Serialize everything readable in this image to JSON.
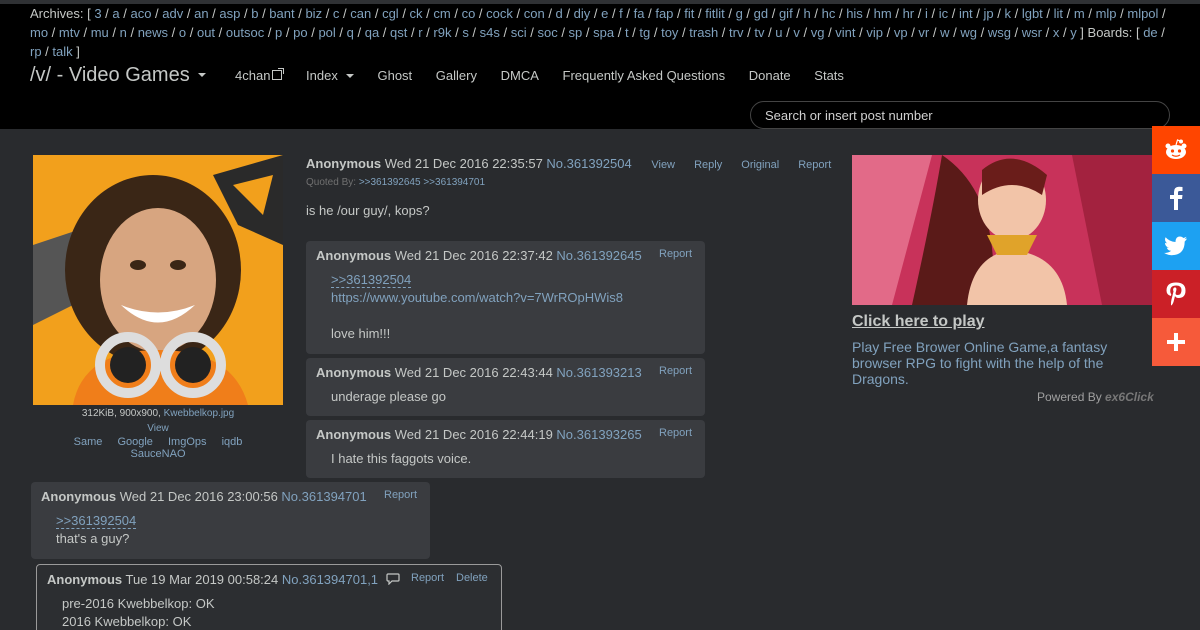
{
  "archives": {
    "label": "Archives:",
    "boards": [
      "3",
      "a",
      "aco",
      "adv",
      "an",
      "asp",
      "b",
      "bant",
      "biz",
      "c",
      "can",
      "cgl",
      "ck",
      "cm",
      "co",
      "cock",
      "con",
      "d",
      "diy",
      "e",
      "f",
      "fa",
      "fap",
      "fit",
      "fitlit",
      "g",
      "gd",
      "gif",
      "h",
      "hc",
      "his",
      "hm",
      "hr",
      "i",
      "ic",
      "int",
      "jp",
      "k",
      "lgbt",
      "lit",
      "m",
      "mlp",
      "mlpol",
      "mo",
      "mtv",
      "mu",
      "n",
      "news",
      "o",
      "out",
      "outsoc",
      "p",
      "po",
      "pol",
      "q",
      "qa",
      "qst",
      "r",
      "r9k",
      "s",
      "s4s",
      "sci",
      "soc",
      "sp",
      "spa",
      "t",
      "tg",
      "toy",
      "trash",
      "trv",
      "tv",
      "u",
      "v",
      "vg",
      "vint",
      "vip",
      "vp",
      "vr",
      "w",
      "wg",
      "wsg",
      "wsr",
      "x",
      "y"
    ],
    "boards_label": "Boards:",
    "boards2": [
      "de",
      "rp",
      "talk"
    ]
  },
  "header": {
    "board_title": "/v/ - Video Games",
    "nav": [
      "4chan",
      "Index",
      "Ghost",
      "Gallery",
      "DMCA",
      "Frequently Asked Questions",
      "Donate",
      "Stats"
    ],
    "search_placeholder": "Search or insert post number"
  },
  "op": {
    "name": "Anonymous",
    "date": "Wed 21 Dec 2016 22:35:57",
    "num": "No.361392504",
    "controls": [
      "View",
      "Reply",
      "Original",
      "Report"
    ],
    "quoted_by_label": "Quoted By:",
    "quoted_by": ">>361392645 >>361394701",
    "body": "is he /our guy/, kops?",
    "file_info": "312KiB, 900x900,",
    "file_name": "Kwebbelkop.jpg",
    "file_view": "View",
    "file_tools": [
      "Same",
      "Google",
      "ImgOps",
      "iqdb",
      "SauceNAO"
    ]
  },
  "replies": [
    {
      "name": "Anonymous",
      "date": "Wed 21 Dec 2016 22:37:42",
      "num": "No.361392645",
      "report": "Report",
      "quote": ">>361392504",
      "link": "https://www.youtube.com/watch?v=7WrROpHWis8",
      "text": "love him!!!"
    },
    {
      "name": "Anonymous",
      "date": "Wed 21 Dec 2016 22:43:44",
      "num": "No.361393213",
      "report": "Report",
      "text": "underage please go"
    },
    {
      "name": "Anonymous",
      "date": "Wed 21 Dec 2016 22:44:19",
      "num": "No.361393265",
      "report": "Report",
      "text": "I hate this faggots voice."
    },
    {
      "name": "Anonymous",
      "date": "Wed 21 Dec 2016 23:00:56",
      "num": "No.361394701",
      "report": "Report",
      "quote": ">>361392504",
      "text": "that's a guy?"
    },
    {
      "name": "Anonymous",
      "date": "Tue 19 Mar 2019 00:58:24",
      "num": "No.361394701,1",
      "report": "Report",
      "delete": "Delete",
      "line1": "pre-2016 Kwebbelkop: OK",
      "line2": "2016 Kwebbelkop: OK"
    }
  ],
  "ad": {
    "title": "Click here to play",
    "text": "Play Free Brower Online Game,a fantasy browser RPG to fight with the help of the Dragons.",
    "powered_by": "Powered By",
    "brand": "ex6Click"
  },
  "share": [
    {
      "name": "reddit",
      "color": "#ff4500"
    },
    {
      "name": "facebook",
      "color": "#3b5998"
    },
    {
      "name": "twitter",
      "color": "#1da1f2"
    },
    {
      "name": "pinterest",
      "color": "#cb2027"
    },
    {
      "name": "more",
      "color": "#f65a3a"
    }
  ]
}
